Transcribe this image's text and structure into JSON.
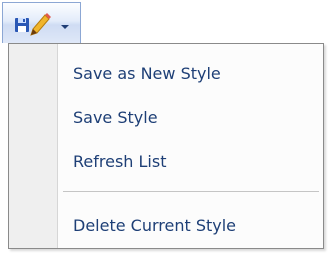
{
  "toolbar": {
    "button_icon": "style-pencil-icon",
    "dropdown_icon": "chevron-down-icon"
  },
  "menu": {
    "items": [
      {
        "label": "Save as New Style"
      },
      {
        "label": "Save Style"
      },
      {
        "label": "Refresh List"
      },
      {
        "label": "Delete Current Style"
      }
    ]
  },
  "colors": {
    "text": "#1e3f76",
    "icon_blue": "#2b58b5",
    "icon_pencil": "#f0b52c",
    "menu_border": "#8a8a8a",
    "gutter": "#efefef"
  }
}
